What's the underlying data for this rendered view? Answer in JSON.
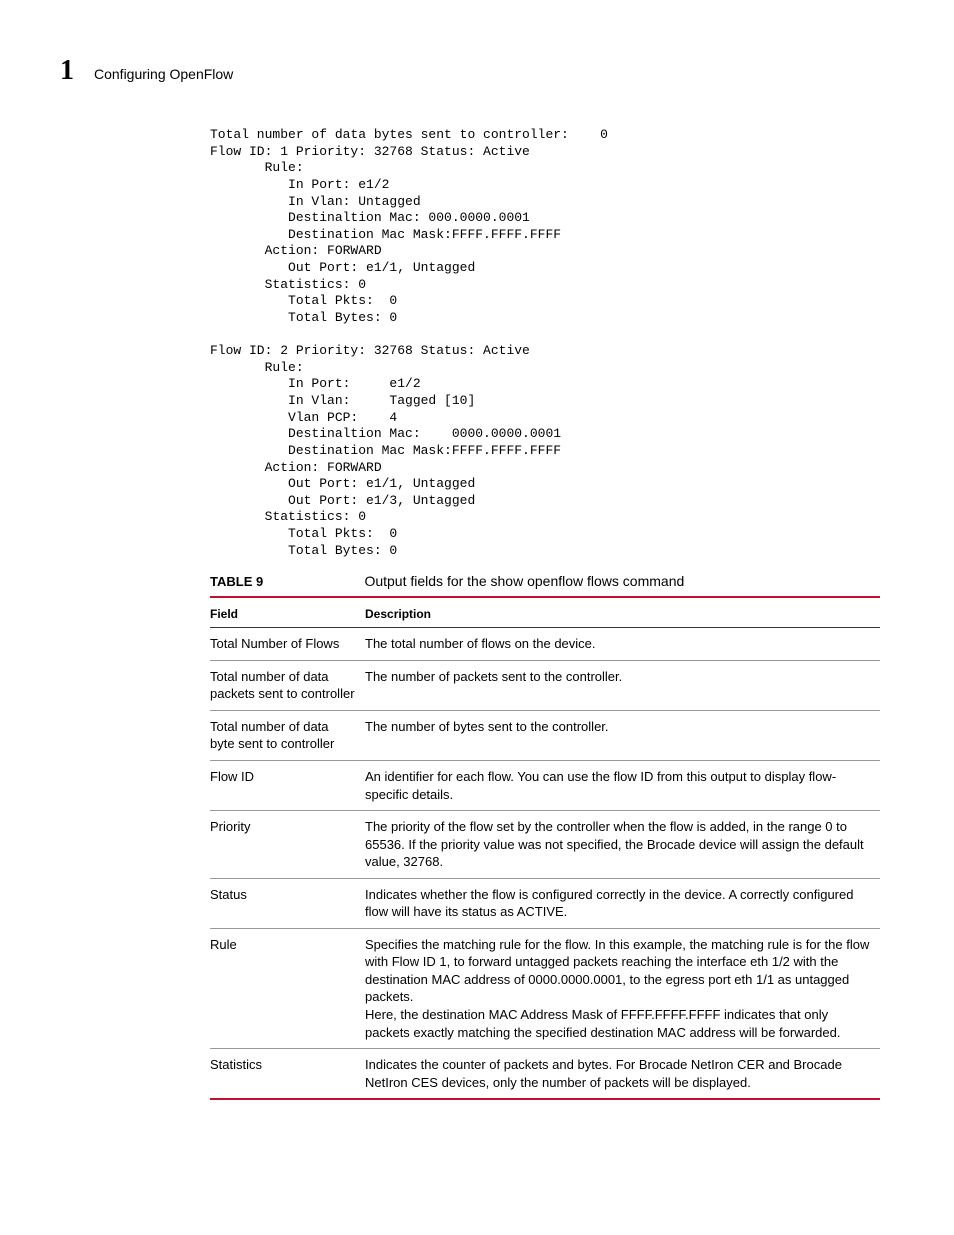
{
  "header": {
    "chapter_number": "1",
    "chapter_title": "Configuring OpenFlow"
  },
  "code": "Total number of data bytes sent to controller:    0\nFlow ID: 1 Priority: 32768 Status: Active\n       Rule:\n          In Port: e1/2\n          In Vlan: Untagged\n          Destinaltion Mac: 000.0000.0001\n          Destination Mac Mask:FFFF.FFFF.FFFF\n       Action: FORWARD\n          Out Port: e1/1, Untagged\n       Statistics: 0\n          Total Pkts:  0\n          Total Bytes: 0\n\nFlow ID: 2 Priority: 32768 Status: Active\n       Rule:\n          In Port:     e1/2\n          In Vlan:     Tagged [10]\n          Vlan PCP:    4\n          Destinaltion Mac:    0000.0000.0001\n          Destination Mac Mask:FFFF.FFFF.FFFF\n       Action: FORWARD\n          Out Port: e1/1, Untagged\n          Out Port: e1/3, Untagged\n       Statistics: 0\n          Total Pkts:  0\n          Total Bytes: 0",
  "table": {
    "label": "TABLE 9",
    "caption": "Output fields for the show openflow flows command",
    "col_field": "Field",
    "col_desc": "Description",
    "rows": [
      {
        "field": "Total Number of Flows",
        "desc": "The total number of flows on the device."
      },
      {
        "field": "Total number of data packets sent to controller",
        "desc": "The number of packets sent to the controller."
      },
      {
        "field": "Total number of data byte sent to controller",
        "desc": "The number of bytes sent to the controller."
      },
      {
        "field": "Flow ID",
        "desc": "An identifier for each flow. You can use the flow ID from this output to display flow-specific details."
      },
      {
        "field": "Priority",
        "desc": "The priority of the flow set by the controller when the flow is added, in the range 0 to 65536. If the priority value was not specified, the Brocade device will assign the default value, 32768."
      },
      {
        "field": "Status",
        "desc": "Indicates whether the flow is configured correctly in the device. A correctly configured flow will have its status as ACTIVE."
      },
      {
        "field": "Rule",
        "desc": "Specifies the matching rule for the flow. In this example, the matching rule is for the flow with Flow ID 1, to forward untagged packets reaching the interface eth 1/2 with the destination MAC address of 0000.0000.0001, to the egress port eth 1/1 as untagged packets.\nHere, the destination MAC Address Mask of FFFF.FFFF.FFFF indicates that only packets exactly matching the specified destination MAC address will be forwarded."
      },
      {
        "field": "Statistics",
        "desc": "Indicates the counter of packets and bytes. For Brocade NetIron CER and Brocade NetIron CES devices, only the number of packets will be displayed."
      }
    ]
  }
}
